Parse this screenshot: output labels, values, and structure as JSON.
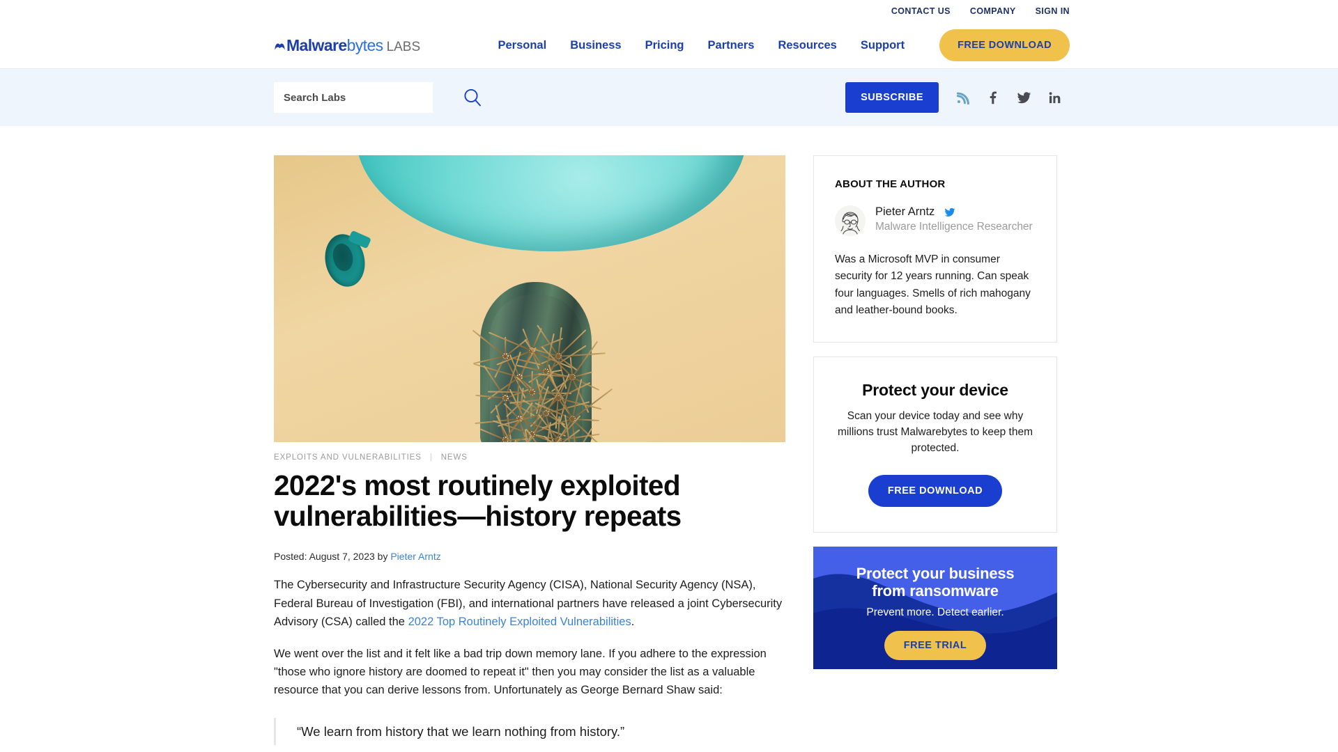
{
  "utility_nav": {
    "items": [
      {
        "label": "CONTACT US",
        "name": "contact-us"
      },
      {
        "label": "COMPANY",
        "name": "company"
      },
      {
        "label": "SIGN IN",
        "name": "sign-in"
      }
    ]
  },
  "brand": {
    "part1": "Malware",
    "part2": "bytes",
    "part3": "LABS"
  },
  "main_nav": {
    "items": [
      {
        "label": "Personal"
      },
      {
        "label": "Business"
      },
      {
        "label": "Pricing"
      },
      {
        "label": "Partners"
      },
      {
        "label": "Resources"
      },
      {
        "label": "Support"
      }
    ],
    "cta_label": "FREE DOWNLOAD"
  },
  "labs_bar": {
    "search_placeholder": "Search Labs",
    "search_value": "",
    "search_icon": "search-icon",
    "subscribe_label": "SUBSCRIBE",
    "social": [
      {
        "name": "rss-icon",
        "label": "RSS"
      },
      {
        "name": "facebook-icon",
        "label": "Facebook"
      },
      {
        "name": "twitter-icon",
        "label": "Twitter"
      },
      {
        "name": "linkedin-icon",
        "label": "LinkedIn"
      }
    ]
  },
  "article": {
    "hero_alt": "Teal balloon floating above a spiky cactus on a tan background",
    "categories": [
      {
        "label": "EXPLOITS AND VULNERABILITIES"
      },
      {
        "label": "NEWS"
      }
    ],
    "category_separator": "|",
    "headline": "2022's most routinely exploited vulnerabilities—history repeats",
    "byline_prefix": "Posted: August 7, 2023 by ",
    "byline_author": "Pieter Arntz",
    "paragraph1_a": "The Cybersecurity and Infrastructure Security Agency (CISA), National Security Agency (NSA), Federal Bureau of Investigation (FBI), and international partners have released a joint Cybersecurity Advisory (CSA) called the ",
    "paragraph1_link": "2022 Top Routinely Exploited Vulnerabilities",
    "paragraph1_b": ".",
    "paragraph2": "We went over the list and it felt like a bad trip down memory lane. If you adhere to the expression \"those who ignore history are doomed to repeat it\" then you may consider the list as a valuable resource that you can derive lessons from. Unfortunately as George Bernard Shaw said:",
    "pullquote": "“We learn from history that we learn nothing from history.”"
  },
  "sidebar": {
    "author_card": {
      "kicker": "ABOUT THE AUTHOR",
      "avatar_name": "author-avatar-sketch",
      "name": "Pieter Arntz",
      "twitter_icon": "twitter-icon",
      "role": "Malware Intelligence Researcher",
      "bio": "Was a Microsoft MVP in consumer security for 12 years running. Can speak four languages. Smells of rich mahogany and leather-bound books."
    },
    "device_card": {
      "title": "Protect your device",
      "text": "Scan your device today and see why millions trust Malwarebytes to keep them protected.",
      "cta_label": "FREE DOWNLOAD"
    },
    "business_card": {
      "title_line1": "Protect your business",
      "title_line2": "from ransomware",
      "subtitle": "Prevent more. Detect earlier.",
      "cta_label": "FREE TRIAL"
    }
  },
  "colors": {
    "brand_blue": "#1c3faa",
    "action_blue": "#1a3fd0",
    "accent_yellow": "#f0c24b",
    "link_blue": "#3b82d6",
    "labs_bar_bg": "#eef5fd",
    "biz_card_bg": "#4560e8",
    "biz_card_deep": "#102a9e"
  }
}
